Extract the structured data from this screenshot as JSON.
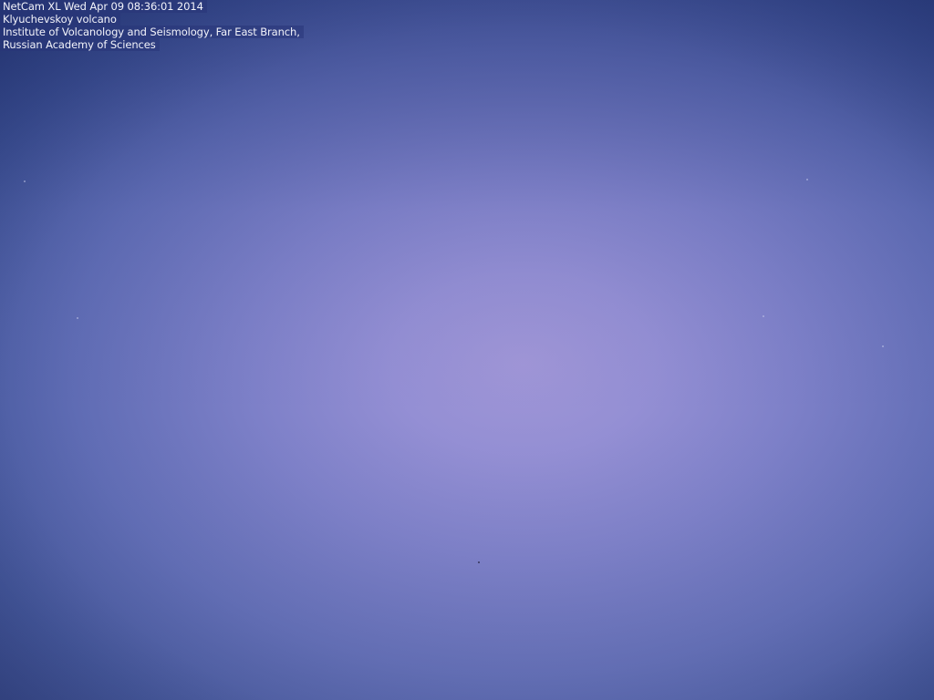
{
  "camera_overlay": {
    "line_1": "NetCam XL Wed Apr 09 08:36:01 2014",
    "line_2": "Klyuchevskoy volcano",
    "line_3": "Institute of Volcanology and Seismology, Far East Branch,",
    "line_4": "Russian Academy of Sciences"
  },
  "scene": {
    "sky_center_color": "#a096d7",
    "sky_edge_color": "#2d4080"
  }
}
